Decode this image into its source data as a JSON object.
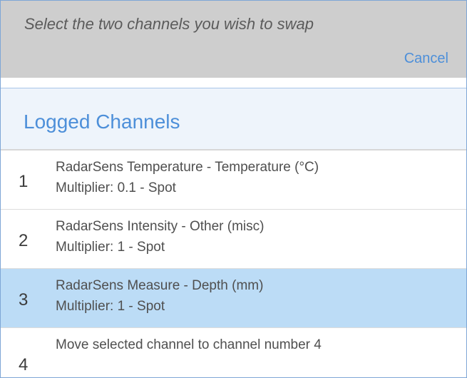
{
  "header": {
    "instruction": "Select the two channels you wish to swap",
    "cancel_label": "Cancel"
  },
  "section": {
    "title": "Logged Channels"
  },
  "channels": [
    {
      "number": "1",
      "name": "RadarSens Temperature - Temperature (°C)",
      "detail": "Multiplier: 0.1 - Spot",
      "selected": false
    },
    {
      "number": "2",
      "name": "RadarSens Intensity - Other (misc)",
      "detail": "Multiplier: 1 - Spot",
      "selected": false
    },
    {
      "number": "3",
      "name": "RadarSens Measure - Depth (mm)",
      "detail": "Multiplier: 1 - Spot",
      "selected": true
    }
  ],
  "move_option": {
    "number": "4",
    "text": "Move selected channel to channel number 4"
  },
  "colors": {
    "accent": "#4d8fd9",
    "selected_row": "#bcdcf6",
    "top_bar": "#cecece"
  }
}
